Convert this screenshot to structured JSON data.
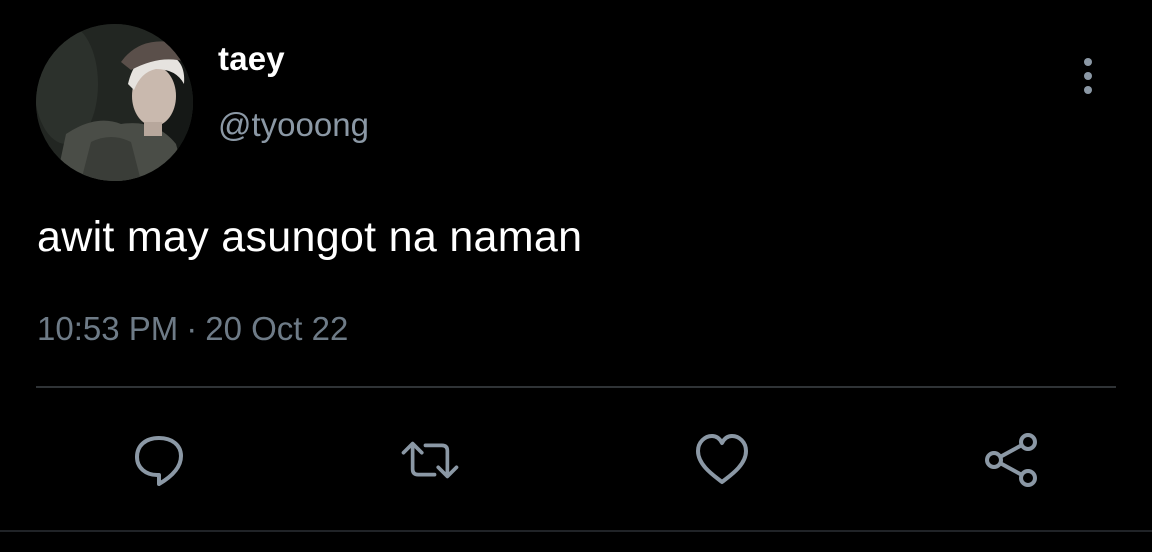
{
  "user": {
    "display_name": "taey",
    "handle": "@tyooong",
    "avatar_icon": "profile-photo"
  },
  "tweet": {
    "text": "awit may asungot na naman",
    "time": "10:53 PM",
    "separator": "·",
    "date": "20 Oct 22"
  },
  "actions": {
    "reply": "reply-icon",
    "retweet": "retweet-icon",
    "like": "heart-icon",
    "share": "share-icon",
    "more": "more-vertical-icon"
  },
  "colors": {
    "background": "#000000",
    "primary_text": "#ffffff",
    "secondary_text": "#8b98a5",
    "icon": "#8b98a5",
    "divider": "#2f3336"
  }
}
